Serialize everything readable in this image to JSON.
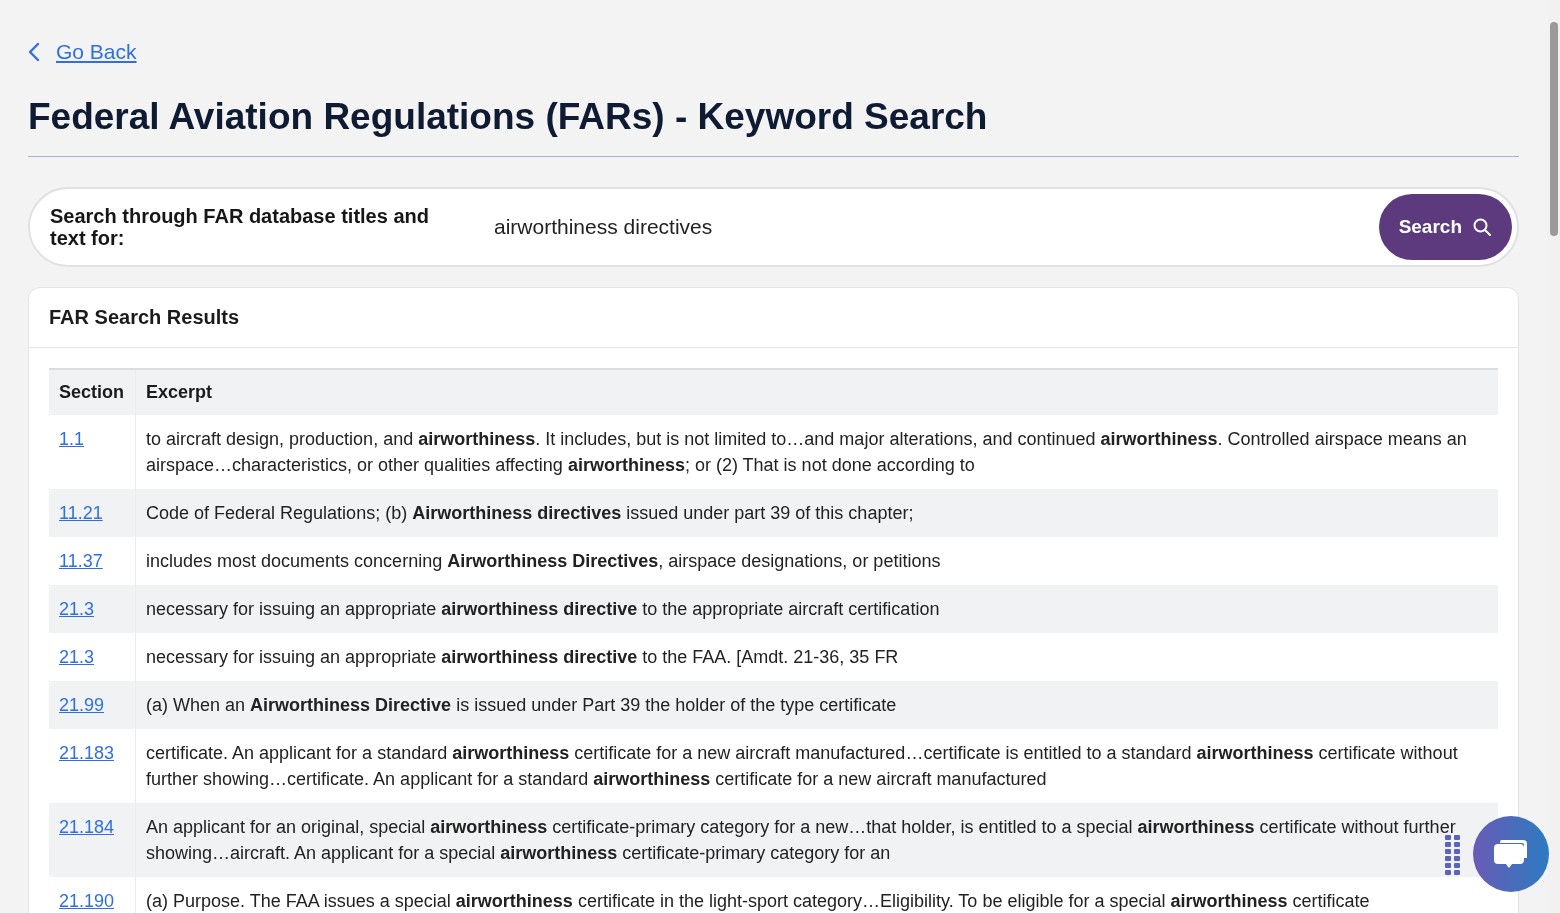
{
  "back_link": "Go Back",
  "title": "Federal Aviation Regulations (FARs) - Keyword Search",
  "search": {
    "label": "Search through FAR database titles and text for:",
    "value": "airworthiness directives",
    "button": "Search"
  },
  "results": {
    "title": "FAR Search Results",
    "table": {
      "columns": [
        "Section",
        "Excerpt"
      ],
      "rows": [
        {
          "section": "1.1",
          "excerpt": "to aircraft design, production, and **airworthiness**. It includes, but is not limited to…and major alterations, and continued **airworthiness**. Controlled airspace means an airspace…characteristics, or other qualities affecting **airworthiness**; or (2) That is not done according to"
        },
        {
          "section": "11.21",
          "excerpt": "Code of Federal Regulations; (b) **Airworthiness directives** issued under part 39 of this chapter;"
        },
        {
          "section": "11.37",
          "excerpt": "includes most documents concerning **Airworthiness Directives**, airspace designations, or petitions"
        },
        {
          "section": "21.3",
          "excerpt": "necessary for issuing an appropriate **airworthiness directive** to the appropriate aircraft certification"
        },
        {
          "section": "21.3",
          "excerpt": "necessary for issuing an appropriate **airworthiness directive** to the FAA. [Amdt. 21-36, 35 FR"
        },
        {
          "section": "21.99",
          "excerpt": "(a) When an **Airworthiness Directive** is issued under Part 39 the holder of the type certificate"
        },
        {
          "section": "21.183",
          "excerpt": "certificate. An applicant for a standard **airworthiness** certificate for a new aircraft manufactured…certificate is entitled to a standard **airworthiness** certificate without further showing…certificate. An applicant for a standard **airworthiness** certificate for a new aircraft manufactured"
        },
        {
          "section": "21.184",
          "excerpt": "An applicant for an original, special **airworthiness** certificate-primary category for a new…that holder, is entitled to a special **airworthiness** certificate without further showing…aircraft. An applicant for a special **airworthiness** certificate-primary category for an"
        },
        {
          "section": "21.190",
          "excerpt": "(a) Purpose. The FAA issues a special **airworthiness** certificate in the light-sport category…Eligibility. To be eligible for a special **airworthiness** certificate"
        }
      ]
    }
  }
}
